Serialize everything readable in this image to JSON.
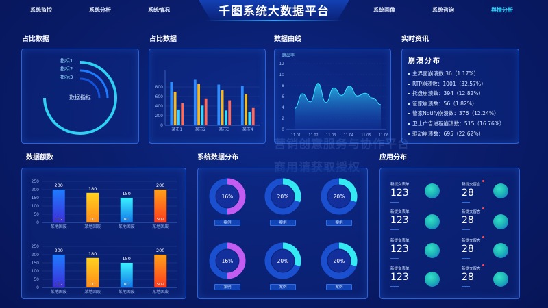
{
  "header": {
    "title": "千图系统大数据平台",
    "nav_left": [
      "系统监控",
      "系统分析",
      "系统情况"
    ],
    "nav_right": [
      "系统画像",
      "系统咨询",
      "舆情分析"
    ],
    "active_nav": "舆情分析"
  },
  "sections": {
    "ratio1": "占比数据",
    "ratio2": "占比数据",
    "curve": "数据曲线",
    "news": "实时资讯",
    "amount": "数据额数",
    "sysdist": "系统数据分布",
    "appdist": "应用分布"
  },
  "arc_panel": {
    "center_label": "数据指标",
    "legend": [
      "指标1",
      "指标2",
      "指标3"
    ]
  },
  "realtime": {
    "heading": "崩溃分布",
    "items": [
      "主界面崩溃数:36（1.17%）",
      "RTP崩溃数：1001（32.57%）",
      "托盘崩溃数：394（12.82%）",
      "管家崩溃数：56（1.82%）",
      "管家Notify崩溃数：376（12.24%）",
      "卫士广告进程崩溃数：515（16.76%）",
      "驱动崩溃数：695（22.62%）"
    ]
  },
  "sys_dist": {
    "case_label": "案例",
    "donuts": [
      {
        "pct": 16,
        "label": "16%",
        "color": "#c35cf0"
      },
      {
        "pct": 20,
        "label": "20%",
        "color": "#35e9f2"
      },
      {
        "pct": 20,
        "label": "20%",
        "color": "#35e9f2"
      },
      {
        "pct": 16,
        "label": "16%",
        "color": "#c35cf0"
      },
      {
        "pct": 20,
        "label": "20%",
        "color": "#35e9f2"
      },
      {
        "pct": 20,
        "label": "20%",
        "color": "#35e9f2"
      }
    ]
  },
  "app_dist": {
    "cells": [
      {
        "label": "新提交表单",
        "value": "123"
      },
      {
        "label": "新提交留言",
        "value": "28"
      },
      {
        "label": "新提交表单",
        "value": "123"
      },
      {
        "label": "新提交留言",
        "value": "28"
      },
      {
        "label": "新提交表单",
        "value": "123"
      },
      {
        "label": "新提交留言",
        "value": "28"
      },
      {
        "label": "新提交表单",
        "value": "123"
      },
      {
        "label": "新提交留言",
        "value": "28"
      }
    ]
  },
  "watermark": {
    "line1": "营销创意服务与协作平台",
    "line2": "商用请获取授权"
  },
  "chart_data": [
    {
      "type": "bar",
      "id": "ratio_bars",
      "categories": [
        "某市1",
        "某市2",
        "某市3",
        "某市4"
      ],
      "ylim": [
        0,
        1000
      ],
      "yticks": [
        0,
        200,
        400,
        600,
        800
      ],
      "series": [
        {
          "values": [
            900,
            950,
            850,
            820
          ],
          "color": "#2b8bff"
        },
        {
          "values": [
            700,
            860,
            730,
            650
          ],
          "color": "#f4b823"
        },
        {
          "values": [
            330,
            410,
            310,
            280
          ],
          "color": "#37d6ff"
        },
        {
          "values": [
            460,
            560,
            520,
            360
          ],
          "color": "#ff6a5a"
        }
      ]
    },
    {
      "type": "area",
      "id": "curve",
      "ylabel": "跳出率",
      "x": [
        "11.01",
        "11.02",
        "11.03",
        "11.04",
        "11.05",
        "11.06"
      ],
      "yticks": [
        0,
        2,
        4,
        6,
        8,
        10,
        12
      ],
      "ylim": [
        0,
        12
      ],
      "values": [
        3.8,
        6.5,
        5.0,
        8.4,
        4.9,
        7.6,
        6.2,
        7.9,
        6.1,
        6.6,
        5.7,
        4.5
      ]
    },
    {
      "type": "bar",
      "id": "amount_top",
      "categories": [
        "某地固废",
        "某地固废",
        "某地固废",
        "某地固废"
      ],
      "bar_labels": [
        "CO2",
        "CO",
        "NO",
        "SO2"
      ],
      "values": [
        200,
        180,
        150,
        200
      ],
      "ylim": [
        0,
        250
      ],
      "yticks": [
        0,
        50,
        100,
        150,
        200,
        250
      ],
      "colors": [
        [
          "#1f7cff",
          "#3c2fd8"
        ],
        [
          "#ffd21f",
          "#ff8b18"
        ],
        [
          "#3af0ff",
          "#1378e8"
        ],
        [
          "#ffa21a",
          "#ff3b1d"
        ]
      ]
    },
    {
      "type": "bar",
      "id": "amount_bottom",
      "categories": [
        "某地固废",
        "某地固废",
        "某地固废",
        "某地固废"
      ],
      "bar_labels": [
        "CO2",
        "CO",
        "NO",
        "SO2"
      ],
      "values": [
        200,
        180,
        150,
        200
      ],
      "ylim": [
        0,
        250
      ],
      "yticks": [
        0,
        50,
        100,
        150,
        200,
        250
      ],
      "colors": [
        [
          "#1f7cff",
          "#3c2fd8"
        ],
        [
          "#ffd21f",
          "#ff8b18"
        ],
        [
          "#3af0ff",
          "#1378e8"
        ],
        [
          "#ffa21a",
          "#ff3b1d"
        ]
      ]
    }
  ]
}
